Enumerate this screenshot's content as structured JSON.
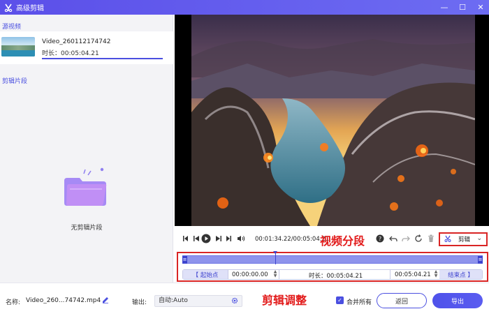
{
  "window": {
    "title": "高级剪辑",
    "minimize": "—",
    "maximize": "☐",
    "close": "✕"
  },
  "left": {
    "source_label": "源视频",
    "source": {
      "name": "Video_260112174742",
      "duration": "时长：00:05:04.21"
    },
    "clips_label": "剪辑片段",
    "empty_text": "无剪辑片段"
  },
  "controls": {
    "timecode": "00:01:34.22/00:05:04.21",
    "segment_annotation": "视频分段",
    "edit_dropdown": "剪辑"
  },
  "timeline": {
    "start_button": "【  起始点",
    "start_value": "00:00:00.00",
    "duration": "时长：00:05:04.21",
    "end_value": "00:05:04.21",
    "end_button": "结束点  】",
    "playhead_fraction": 0.31
  },
  "bottom": {
    "name_label": "名称:",
    "name_value": "Video_260...74742.mp4",
    "output_label": "输出:",
    "output_value": "自动:Auto",
    "adjust_annotation": "剪辑调整",
    "merge_label": "合并所有",
    "back_button": "返回",
    "export_button": "导出"
  },
  "colors": {
    "accent": "#4a4fe0",
    "annotation": "#e21b1b"
  }
}
